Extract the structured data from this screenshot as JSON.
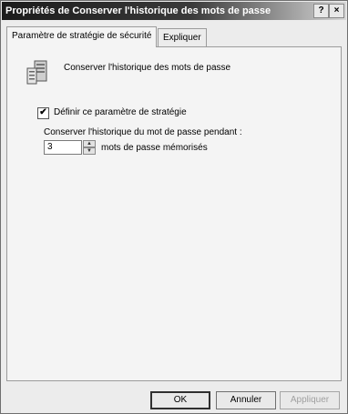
{
  "window": {
    "title": "Propriétés de Conserver l'historique des mots de passe",
    "help_label": "?",
    "close_label": "×"
  },
  "tabs": [
    {
      "label": "Paramètre de stratégie de sécurité",
      "active": true
    },
    {
      "label": "Expliquer",
      "active": false
    }
  ],
  "policy": {
    "icon": "server-policy-icon",
    "name": "Conserver l'historique des mots de passe"
  },
  "define_setting": {
    "checked": true,
    "check_mark": "✔",
    "label": "Définir ce paramètre de stratégie"
  },
  "history": {
    "label": "Conserver l'historique du mot de passe pendant :",
    "value": "3",
    "unit": "mots de passe mémorisés"
  },
  "buttons": {
    "ok": "OK",
    "cancel": "Annuler",
    "apply": "Appliquer"
  }
}
